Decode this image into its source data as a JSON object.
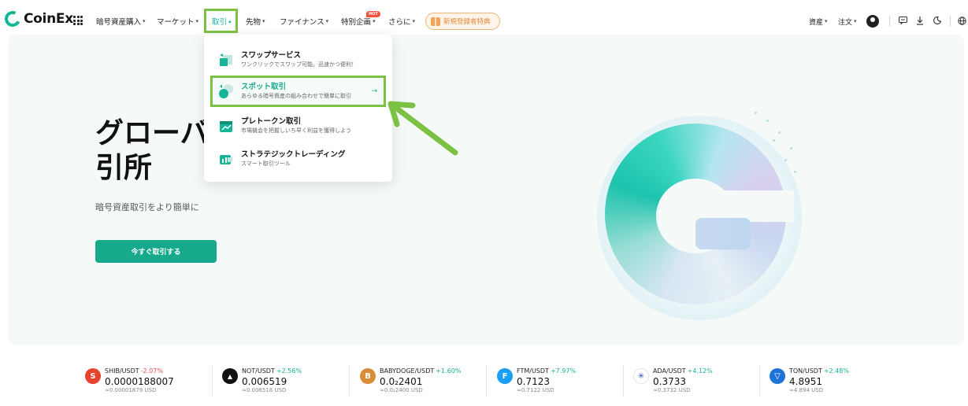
{
  "brand": {
    "name": "CoinEx",
    "accent": "#17b598",
    "highlight": "#7bc143"
  },
  "nav": {
    "items": [
      {
        "label": "暗号資産購入",
        "caret": "▾"
      },
      {
        "label": "マーケット",
        "caret": "▾"
      },
      {
        "label": "取引",
        "caret": "▴"
      },
      {
        "label": "先物",
        "caret": "▾"
      },
      {
        "label": "ファイナンス",
        "caret": "▾"
      },
      {
        "label": "特別企画",
        "caret": "▾"
      },
      {
        "label": "さらに",
        "caret": "▾"
      }
    ],
    "hot_badge": "HOT",
    "promo": "新規登録者特典",
    "right": {
      "assets": "資産",
      "orders": "注文",
      "caret": "▾"
    }
  },
  "hero": {
    "title_line1": "グローバル暗号資産取",
    "title_line2": "引所",
    "subtitle": "暗号資産取引をより簡単に",
    "cta": "今すぐ取引する"
  },
  "dropdown": {
    "items": [
      {
        "title": "スワップサービス",
        "desc": "ワンクリックでスワップ可能。迅速かつ便利！",
        "icon": "swap-icon"
      },
      {
        "title": "スポット取引",
        "desc": "あらゆる暗号資産の組み合わせで簡単に取引",
        "icon": "spot-icon",
        "active": true
      },
      {
        "title": "プレトークン取引",
        "desc": "市場機会を把握しいち早く利益を獲得しよう",
        "icon": "pretoken-icon"
      },
      {
        "title": "ストラテジックトレーディング",
        "desc": "スマート取引ツール",
        "icon": "strategy-icon"
      }
    ],
    "arrow": "→"
  },
  "ticker": [
    {
      "pair": "SHIB/USDT",
      "change": "-2.07%",
      "price": "0.0000188007",
      "usd": "≈0.00001879 USD",
      "color": "#e8412c",
      "glyph": "S"
    },
    {
      "pair": "NOT/USDT",
      "change": "+2.56%",
      "price": "0.006519",
      "usd": "≈0.006518 USD",
      "color": "#111111",
      "glyph": "▲"
    },
    {
      "pair": "BABYDOGE/USDT",
      "change": "+1.60%",
      "price": "0.0₂2401",
      "usd": "≈0.0₂2400 USD",
      "color": "#d98b3a",
      "glyph": "B"
    },
    {
      "pair": "FTM/USDT",
      "change": "+7.97%",
      "price": "0.7123",
      "usd": "≈0.7122 USD",
      "color": "#1a9ff5",
      "glyph": "F"
    },
    {
      "pair": "ADA/USDT",
      "change": "+4.12%",
      "price": "0.3733",
      "usd": "≈0.3732 USD",
      "color": "#2a4fb8",
      "glyph": "✳"
    },
    {
      "pair": "TON/USDT",
      "change": "+2.48%",
      "price": "4.8951",
      "usd": "≈4.894 USD",
      "color": "#1e73d8",
      "glyph": "▽"
    }
  ]
}
